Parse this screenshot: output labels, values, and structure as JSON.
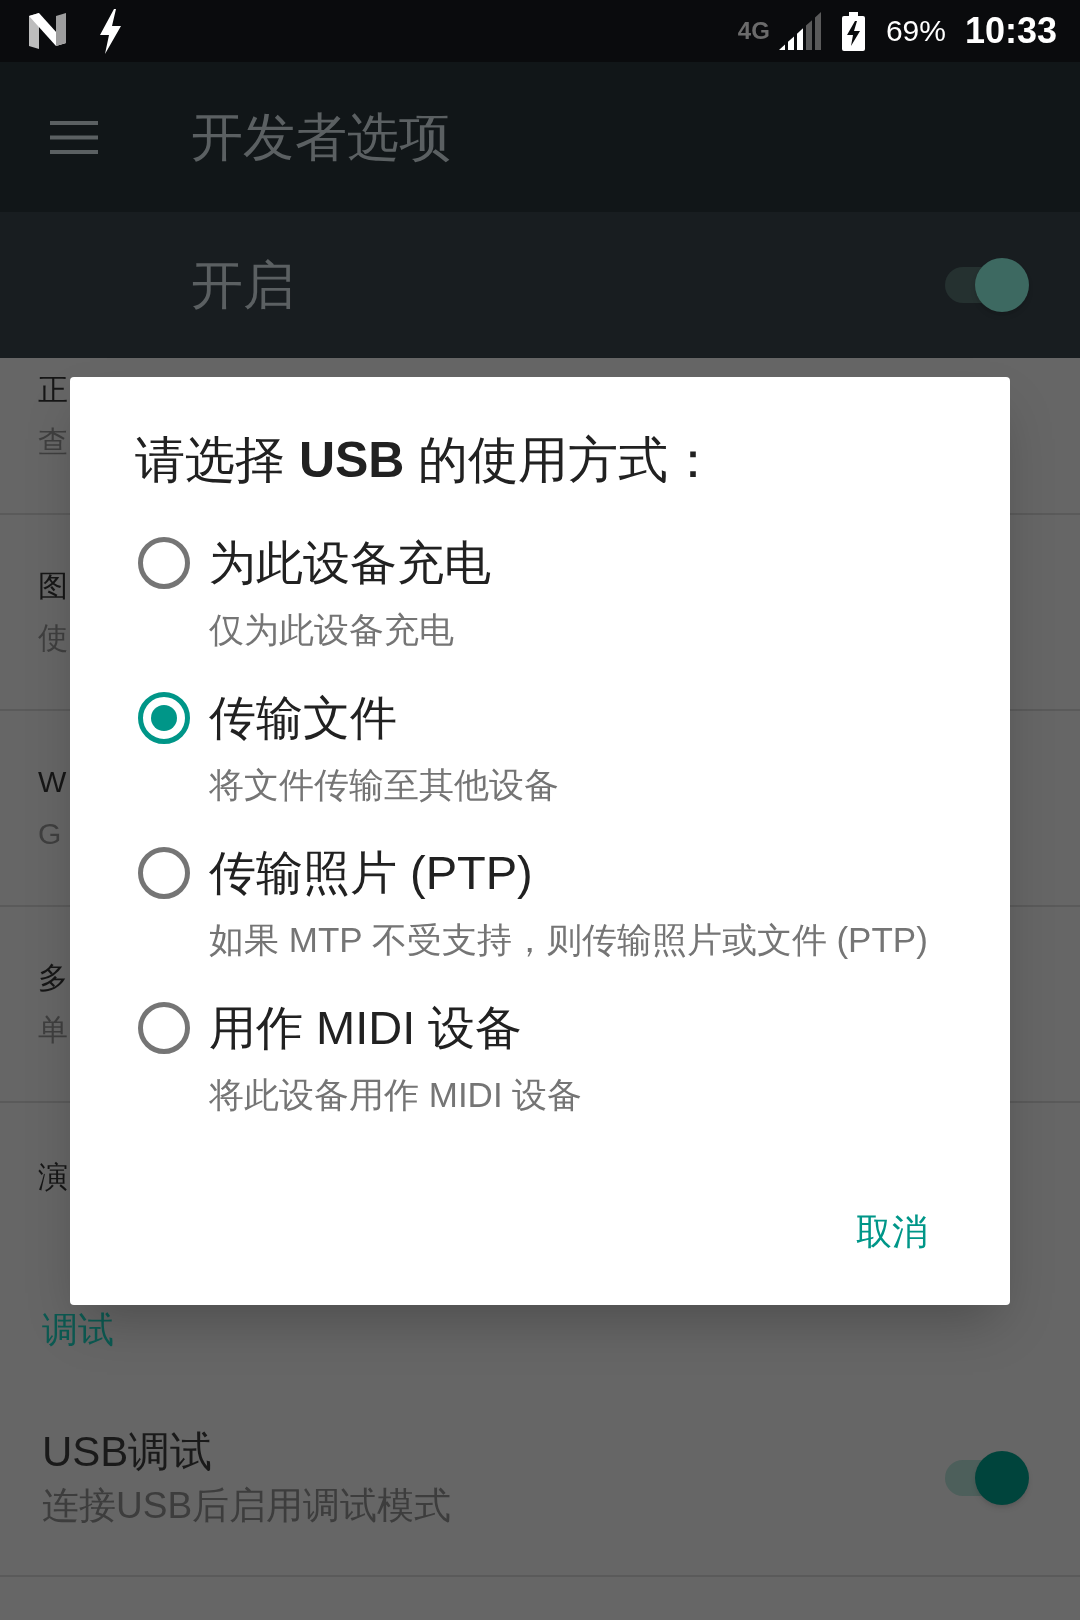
{
  "status_bar": {
    "network": "4G",
    "battery": "69%",
    "time": "10:33"
  },
  "toolbar": {
    "title": "开发者选项"
  },
  "master_switch": {
    "label": "开启",
    "on": true
  },
  "settings_list": [
    {
      "title": "正",
      "summary": "查"
    },
    {
      "title": "图",
      "summary": "使"
    },
    {
      "title": "W",
      "summary": "G"
    },
    {
      "title": "多",
      "summary": "单"
    },
    {
      "title": "演"
    }
  ],
  "category": "调试",
  "usb_debugging": {
    "title": "USB调试",
    "summary": "连接USB后启用调试模式",
    "on": true
  },
  "dialog": {
    "title": "请选择 **USB** 的使用方式：",
    "options": [
      {
        "label": "为此设备充电",
        "description": "仅为此设备充电",
        "selected": false
      },
      {
        "label": "传输文件",
        "description": "将文件传输至其他设备",
        "selected": true
      },
      {
        "label": "传输照片 (PTP)",
        "description": "如果 MTP 不受支持，则传输照片或文件 (PTP)",
        "selected": false
      },
      {
        "label": "用作 MIDI 设备",
        "description": "将此设备用作 MIDI 设备",
        "selected": false
      }
    ],
    "buttons": [
      "取消"
    ]
  }
}
